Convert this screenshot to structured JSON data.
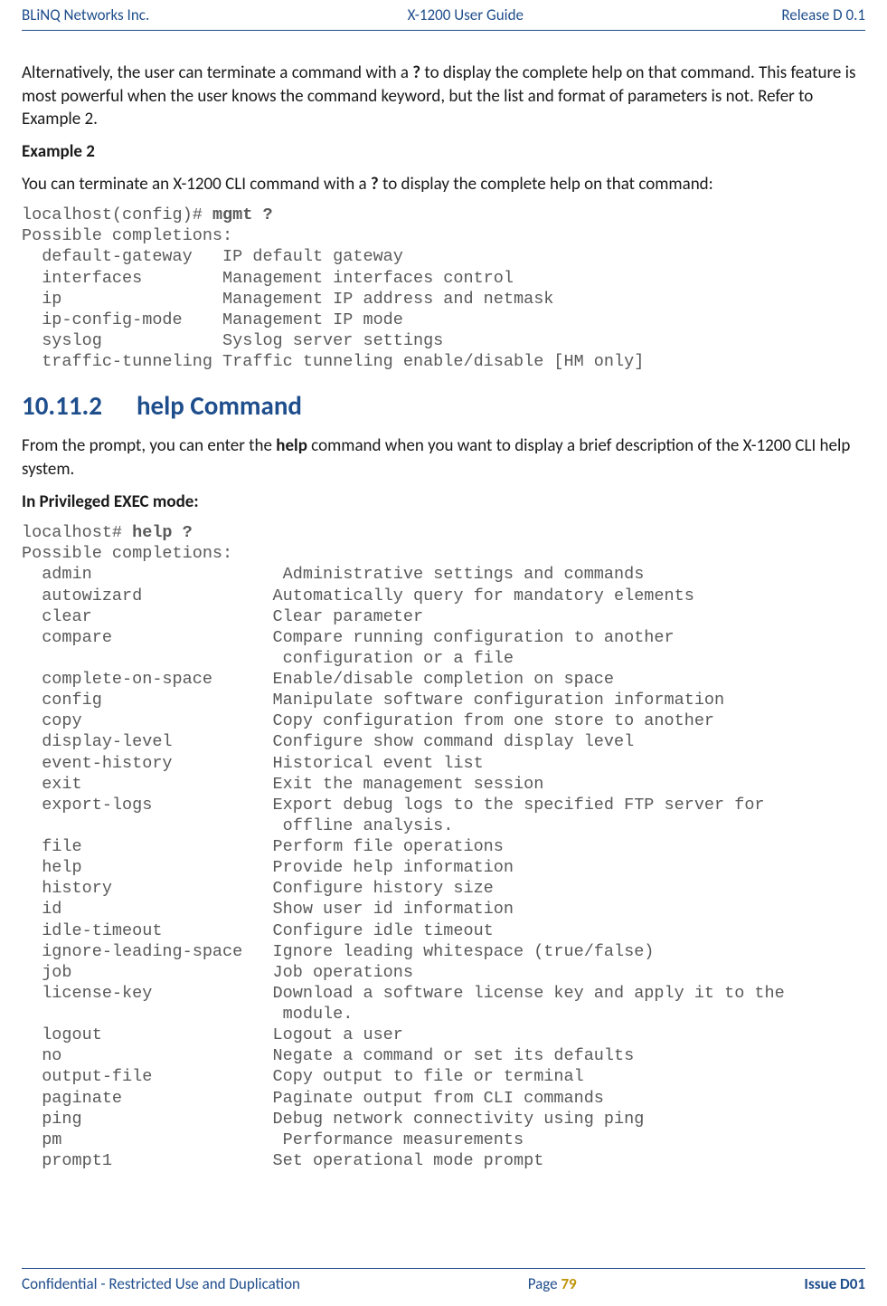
{
  "header": {
    "left": "BLiNQ Networks Inc.",
    "center": "X-1200 User Guide",
    "right": "Release D 0.1"
  },
  "footer": {
    "left": "Confidential - Restricted Use and Duplication",
    "center_prefix": "Page ",
    "center_num": "79",
    "right": "Issue D01"
  },
  "para1_a": "Alternatively, the user can terminate a command with a ",
  "para1_q": "?",
  "para1_b": " to display the complete help on that command.  This feature is most powerful when the user knows the command keyword, but the list and format of parameters is not. Refer to Example 2.",
  "example2_label": "Example 2",
  "para2_a": "You can terminate an X-1200 CLI command with a ",
  "para2_q": "?",
  "para2_b": " to display the complete help on that command:",
  "code1_prompt": "localhost(config)# ",
  "code1_cmd": "mgmt ?",
  "code1_body": "Possible completions:\n  default-gateway   IP default gateway\n  interfaces        Management interfaces control\n  ip                Management IP address and netmask\n  ip-config-mode    Management IP mode\n  syslog            Syslog server settings\n  traffic-tunneling Traffic tunneling enable/disable [HM only]",
  "section_num": "10.11.2",
  "section_title": "help Command",
  "para3_a": "From the prompt, you can enter the ",
  "para3_help": "help",
  "para3_b": " command when you want to display a brief description of the X-1200 CLI help system.",
  "priv_label": "In Privileged EXEC mode:",
  "code2_prompt": "localhost# ",
  "code2_cmd": "help ?",
  "code2_body": "Possible completions:\n  admin                   Administrative settings and commands\n  autowizard             Automatically query for mandatory elements\n  clear                  Clear parameter\n  compare                Compare running configuration to another \n                          configuration or a file\n  complete-on-space      Enable/disable completion on space\n  config                 Manipulate software configuration information\n  copy                   Copy configuration from one store to another\n  display-level          Configure show command display level\n  event-history          Historical event list\n  exit                   Exit the management session\n  export-logs            Export debug logs to the specified FTP server for \n                          offline analysis.\n  file                   Perform file operations\n  help                   Provide help information\n  history                Configure history size\n  id                     Show user id information\n  idle-timeout           Configure idle timeout\n  ignore-leading-space   Ignore leading whitespace (true/false)\n  job                    Job operations\n  license-key            Download a software license key and apply it to the \n                          module.\n  logout                 Logout a user\n  no                     Negate a command or set its defaults\n  output-file            Copy output to file or terminal\n  paginate               Paginate output from CLI commands\n  ping                   Debug network connectivity using ping\n  pm                      Performance measurements\n  prompt1                Set operational mode prompt"
}
